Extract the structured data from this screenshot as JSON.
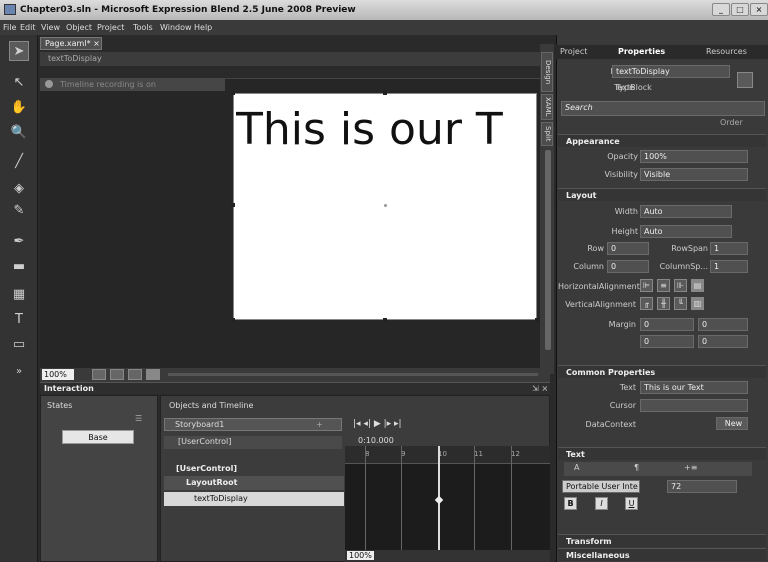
{
  "window": {
    "title": "Chapter03.sln - Microsoft Expression Blend 2.5 June 2008 Preview"
  },
  "menu": [
    "File",
    "Edit",
    "View",
    "Object",
    "Project",
    "Tools",
    "Window",
    "Help"
  ],
  "document": {
    "tab": "Page.xaml* ×",
    "breadcrumb": "textToDisplay",
    "timeline_recording": "Timeline recording is on",
    "artboard_text": "This is our T",
    "view_tabs": [
      "Design",
      "XAML",
      "Split"
    ],
    "zoom": "100%"
  },
  "interaction": {
    "title": "Interaction",
    "states_header": "States",
    "base_state": "Base",
    "objects_header": "Objects and Timeline",
    "storyboard": "Storyboard1",
    "time": "0:10.000",
    "usercontrol_bracket": "[UserControl]",
    "tree": [
      "[UserControl]",
      "LayoutRoot",
      "textToDisplay"
    ],
    "ruler_ticks": [
      "8",
      "9",
      "10",
      "11",
      "12"
    ],
    "timeline_zoom": "100%"
  },
  "properties": {
    "tabs": [
      "Project",
      "Properties",
      "Resources"
    ],
    "name_label": "Name",
    "name_value": "textToDisplay",
    "type_label": "Type",
    "type_value": "TextBlock",
    "search_label": "Search",
    "order_label": "Order",
    "sections": {
      "appearance": "Appearance",
      "layout": "Layout",
      "common": "Common Properties",
      "text": "Text",
      "transform": "Transform",
      "misc": "Miscellaneous"
    },
    "opacity_label": "Opacity",
    "opacity": "100%",
    "visibility_label": "Visibility",
    "visibility": "Visible",
    "width_label": "Width",
    "width": "Auto",
    "height_label": "Height",
    "height": "Auto",
    "row_label": "Row",
    "row": "0",
    "rowspan_label": "RowSpan",
    "rowspan": "1",
    "column_label": "Column",
    "column": "0",
    "colspan_label": "ColumnSp...",
    "colspan": "1",
    "halign_label": "HorizontalAlignment",
    "valign_label": "VerticalAlignment",
    "margin_label": "Margin",
    "margins": [
      "0",
      "0",
      "0",
      "0"
    ],
    "text_label": "Text",
    "text_value": "This is our Text",
    "cursor_label": "Cursor",
    "datacontext_label": "DataContext",
    "new_button": "New",
    "font_family": "Portable User Inte",
    "font_size": "72"
  }
}
